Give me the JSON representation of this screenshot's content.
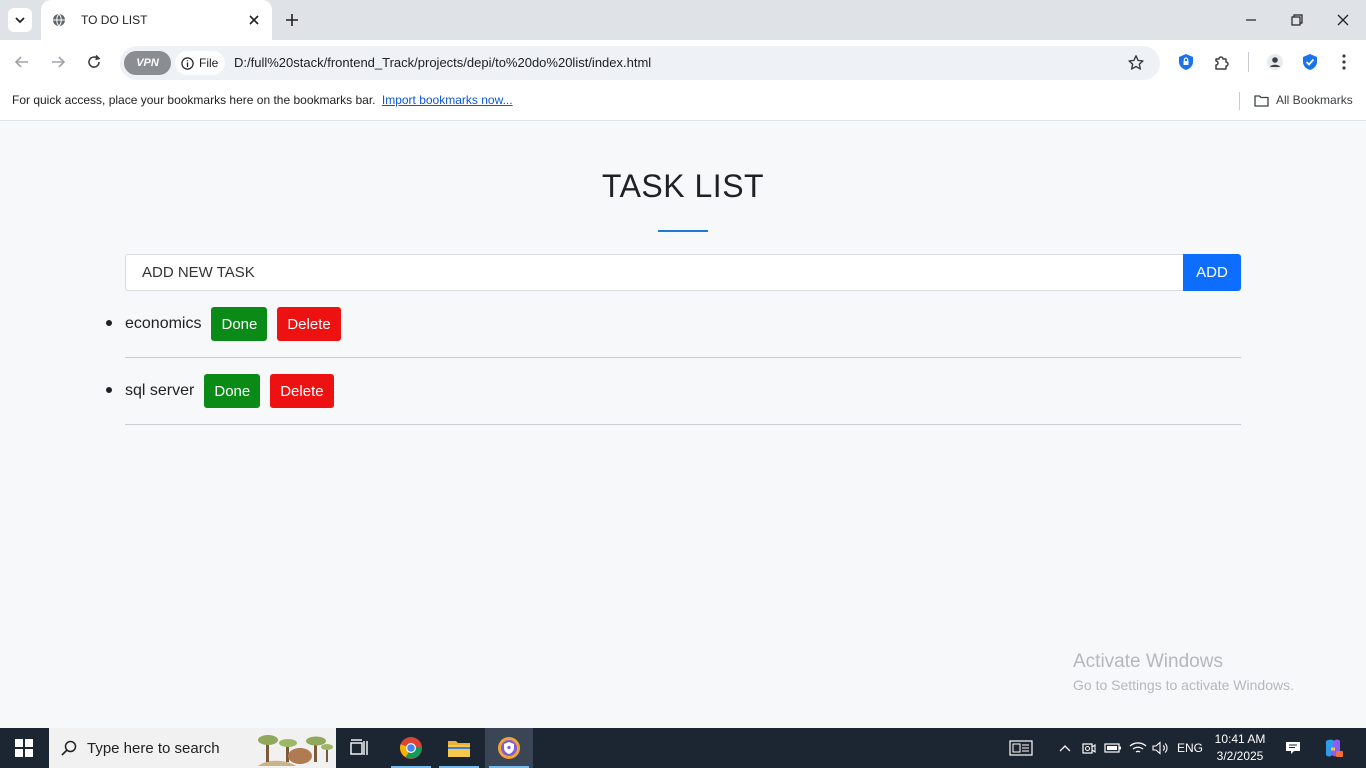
{
  "browser": {
    "tab_title": "TO DO LIST",
    "vpn_label": "VPN",
    "file_label": "File",
    "url": "D:/full%20stack/frontend_Track/projects/depi/to%20do%20list/index.html",
    "bookmarks_hint": "For quick access, place your bookmarks here on the bookmarks bar.",
    "import_link": "Import bookmarks now...",
    "all_bookmarks": "All Bookmarks"
  },
  "app": {
    "title": "TASK LIST",
    "input_placeholder": "ADD NEW TASK",
    "add_label": "ADD",
    "done_label": "Done",
    "delete_label": "Delete",
    "tasks": [
      {
        "name": "economics"
      },
      {
        "name": "sql server"
      }
    ]
  },
  "watermark": {
    "line1": "Activate Windows",
    "line2": "Go to Settings to activate Windows."
  },
  "taskbar": {
    "search_placeholder": "Type here to search",
    "language": "ENG",
    "time": "10:41 AM",
    "date": "3/2/2025"
  },
  "colors": {
    "accent_blue": "#0d6efd",
    "done_green": "#0a8a17",
    "delete_red": "#ee1111"
  }
}
